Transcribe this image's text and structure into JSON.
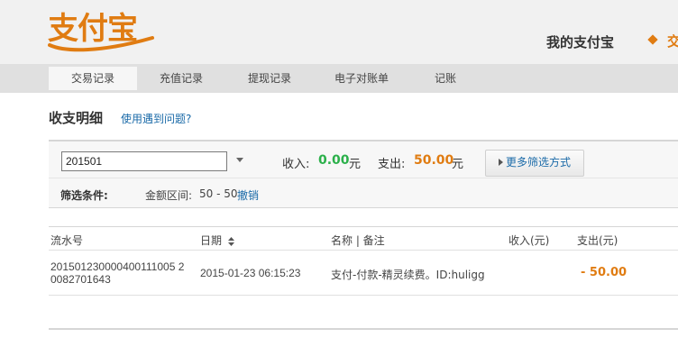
{
  "header": {
    "logo_text": "支付宝",
    "my_alipay": "我的支付宝",
    "trade_partial": "交"
  },
  "nav": {
    "items": [
      {
        "label": "交易记录",
        "active": true
      },
      {
        "label": "充值记录",
        "active": false
      },
      {
        "label": "提现记录",
        "active": false
      },
      {
        "label": "电子对账单",
        "active": false
      },
      {
        "label": "记账",
        "active": false
      }
    ]
  },
  "page": {
    "title": "收支明细",
    "help_link": "使用遇到问题?"
  },
  "filter": {
    "date_value": "201501",
    "income_label": "收入:",
    "income_value": "0.00",
    "income_unit": "元",
    "expense_label": "支出:",
    "expense_value": "50.00",
    "expense_unit": "元",
    "more_filters": "更多筛选方式",
    "condition_label": "筛选条件:",
    "amount_range_label": "金额区间:",
    "amount_range_value": "50 - 50",
    "cancel": "撤销"
  },
  "table": {
    "columns": [
      "流水号",
      "日期",
      "名称 | 备注",
      "收入(元)",
      "支出(元)"
    ],
    "rows": [
      {
        "serial_line1": "201501230000400111005 2",
        "serial_line2": "0082701643",
        "date": "2015-01-23 06:15:23",
        "name": "支付-付款-精灵续费。ID:huligg",
        "income": "",
        "expense": "- 50.00"
      }
    ]
  },
  "colors": {
    "brand_orange": "#e07c12",
    "income_green": "#2bb04a",
    "link_blue": "#1a6aa8"
  }
}
